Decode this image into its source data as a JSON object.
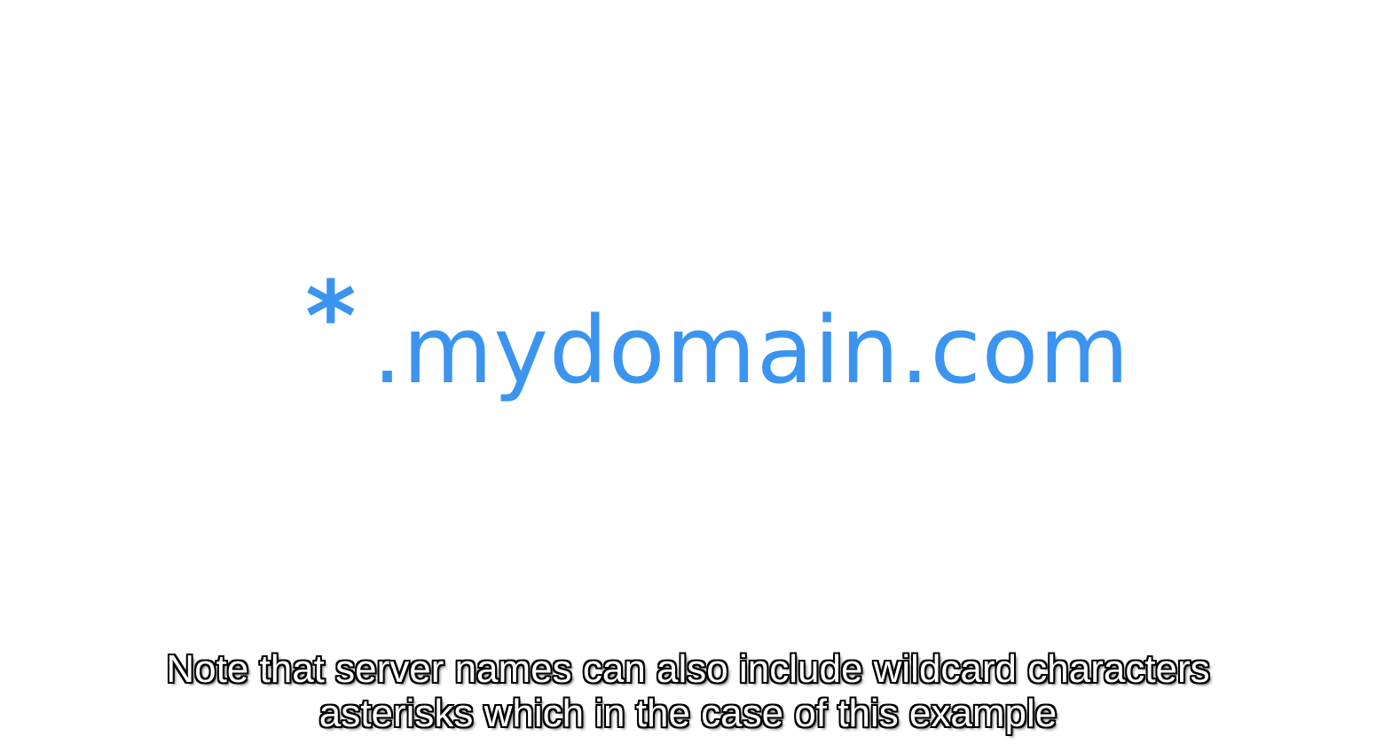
{
  "slide": {
    "wildcard": "*",
    "domain": ".mydomain.com",
    "accent_color": "#3b94f0"
  },
  "caption": {
    "line1": "Note that server names can also include wildcard characters",
    "line2": "asterisks which in the case of this example"
  }
}
